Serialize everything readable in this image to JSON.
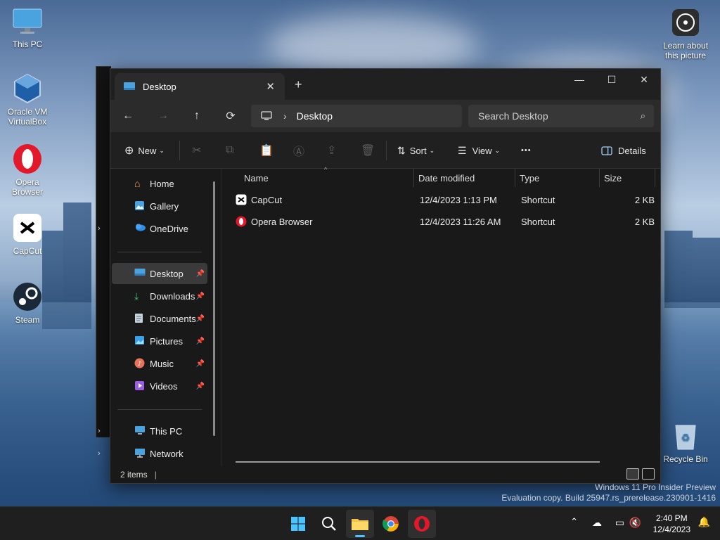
{
  "desktop": {
    "icons": [
      {
        "label": "This PC"
      },
      {
        "label": "Oracle VM VirtualBox"
      },
      {
        "label": "Opera Browser"
      },
      {
        "label": "CapCut"
      },
      {
        "label": "Steam"
      },
      {
        "label": "Learn about this picture"
      },
      {
        "label": "Recycle Bin"
      }
    ],
    "watermark_line1": "Windows 11 Pro Insider Preview",
    "watermark_line2": "Evaluation copy. Build 25947.rs_prerelease.230901-1416"
  },
  "window": {
    "tab_title": "Desktop",
    "new_tab": "+",
    "close_tab": "✕",
    "minimize": "—",
    "maximize": "☐",
    "close": "✕"
  },
  "address": {
    "path": "Desktop",
    "separator": "›",
    "search_placeholder": "Search Desktop"
  },
  "toolbar": {
    "new_label": "New",
    "sort_label": "Sort",
    "view_label": "View",
    "more_label": "•••",
    "details_label": "Details"
  },
  "nav": {
    "quick": [
      {
        "label": "Home"
      },
      {
        "label": "Gallery"
      },
      {
        "label": "OneDrive"
      }
    ],
    "pinned": [
      {
        "label": "Desktop"
      },
      {
        "label": "Downloads"
      },
      {
        "label": "Documents"
      },
      {
        "label": "Pictures"
      },
      {
        "label": "Music"
      },
      {
        "label": "Videos"
      }
    ],
    "bottom": [
      {
        "label": "This PC"
      },
      {
        "label": "Network"
      }
    ]
  },
  "columns": {
    "name": "Name",
    "date": "Date modified",
    "type": "Type",
    "size": "Size"
  },
  "files": [
    {
      "name": "CapCut",
      "date": "12/4/2023 1:13 PM",
      "type": "Shortcut",
      "size": "2 KB"
    },
    {
      "name": "Opera Browser",
      "date": "12/4/2023 11:26 AM",
      "type": "Shortcut",
      "size": "2 KB"
    }
  ],
  "status": {
    "items": "2 items",
    "cursor": "|"
  },
  "taskbar": {
    "time": "2:40 PM",
    "date": "12/4/2023"
  },
  "colors": {
    "accent": "#4cc2ff",
    "opera_red": "#e3192b",
    "window_bg": "#191919"
  }
}
